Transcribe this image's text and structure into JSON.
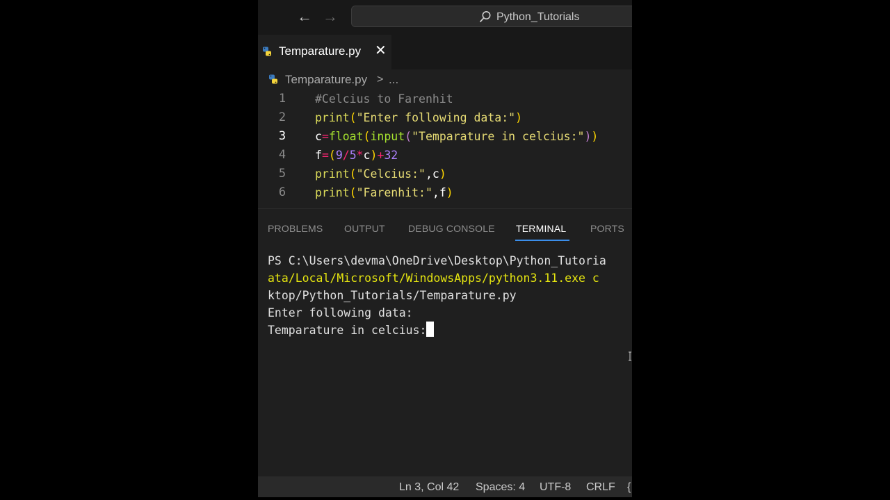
{
  "titlebar": {
    "back_icon": "←",
    "forward_icon": "→",
    "command_center_text": "Python_Tutorials"
  },
  "tab": {
    "label": "Temparature.py",
    "close_icon": "✕"
  },
  "breadcrumb": {
    "file": "Temparature.py",
    "separator": ">",
    "more": "..."
  },
  "editor": {
    "line_numbers": [
      "1",
      "2",
      "3",
      "4",
      "5",
      "6"
    ],
    "active_line": 3,
    "code_lines": [
      [
        {
          "t": "#Celcius to Farenhit",
          "c": "#8b8b8b"
        }
      ],
      [
        {
          "t": "print",
          "c": "#dcdc5a"
        },
        {
          "t": "(",
          "c": "#ffd700"
        },
        {
          "t": "\"Enter following data:\"",
          "c": "#e6db74"
        },
        {
          "t": ")",
          "c": "#ffd700"
        }
      ],
      [
        {
          "t": "c",
          "c": "#ffffff"
        },
        {
          "t": "=",
          "c": "#f92672"
        },
        {
          "t": "float",
          "c": "#a6e22e"
        },
        {
          "t": "(",
          "c": "#ffd700"
        },
        {
          "t": "input",
          "c": "#a6e22e"
        },
        {
          "t": "(",
          "c": "#c27fd1"
        },
        {
          "t": "\"Temparature in celcius:\"",
          "c": "#e6db74"
        },
        {
          "t": ")",
          "c": "#c27fd1"
        },
        {
          "t": ")",
          "c": "#ffd700"
        }
      ],
      [
        {
          "t": "f",
          "c": "#ffffff"
        },
        {
          "t": "=",
          "c": "#f92672"
        },
        {
          "t": "(",
          "c": "#ffd700"
        },
        {
          "t": "9",
          "c": "#ae81ff"
        },
        {
          "t": "/",
          "c": "#f92672"
        },
        {
          "t": "5",
          "c": "#ae81ff"
        },
        {
          "t": "*",
          "c": "#f92672"
        },
        {
          "t": "c",
          "c": "#ffffff"
        },
        {
          "t": ")",
          "c": "#ffd700"
        },
        {
          "t": "+",
          "c": "#f92672"
        },
        {
          "t": "32",
          "c": "#ae81ff"
        }
      ],
      [
        {
          "t": "print",
          "c": "#dcdc5a"
        },
        {
          "t": "(",
          "c": "#ffd700"
        },
        {
          "t": "\"Celcius:\"",
          "c": "#e6db74"
        },
        {
          "t": ",c",
          "c": "#ffffff"
        },
        {
          "t": ")",
          "c": "#ffd700"
        }
      ],
      [
        {
          "t": "print",
          "c": "#dcdc5a"
        },
        {
          "t": "(",
          "c": "#ffd700"
        },
        {
          "t": "\"Farenhit:\"",
          "c": "#e6db74"
        },
        {
          "t": ",f",
          "c": "#ffffff"
        },
        {
          "t": ")",
          "c": "#ffd700"
        }
      ]
    ]
  },
  "panel": {
    "tabs": {
      "problems": "PROBLEMS",
      "output": "OUTPUT",
      "debug_console": "DEBUG CONSOLE",
      "terminal": "TERMINAL",
      "ports": "PORTS"
    },
    "active_tab": "TERMINAL",
    "terminal_lines": [
      {
        "text": "PS C:\\Users\\devma\\OneDrive\\Desktop\\Python_Tutoria",
        "style": "normal"
      },
      {
        "text": "ata/Local/Microsoft/WindowsApps/python3.11.exe c",
        "style": "yellow"
      },
      {
        "text": "ktop/Python_Tutorials/Temparature.py",
        "style": "normal"
      },
      {
        "text": "Enter following data:",
        "style": "normal"
      },
      {
        "text": "Temparature in celcius:",
        "style": "normal",
        "cursor": true
      }
    ]
  },
  "statusbar": {
    "position": "Ln 3, Col 42",
    "spaces": "Spaces: 4",
    "encoding": "UTF-8",
    "eol": "CRLF",
    "language_icon": "{"
  },
  "colors": {
    "editor_bg": "#1f1f1f",
    "chrome_bg": "#181818",
    "accent": "#3b8eea",
    "python_blue": "#3b7bbf",
    "python_yellow": "#f5d43b"
  }
}
